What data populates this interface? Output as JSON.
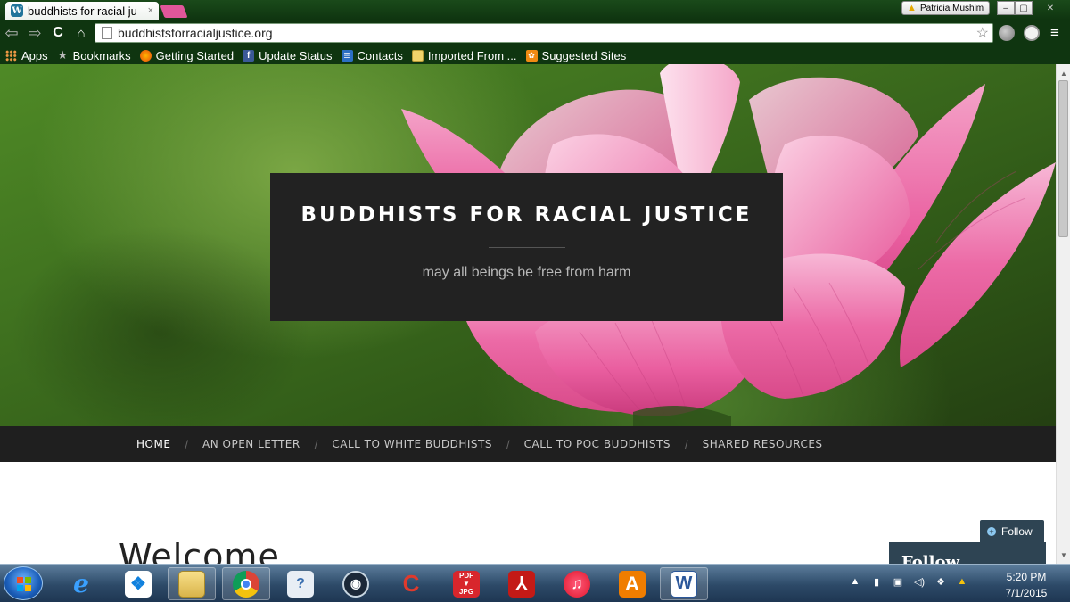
{
  "browser": {
    "tab_title": "buddhists for racial ju",
    "favicon_letter": "W",
    "tab_close": "×",
    "profile_name": "Patricia Mushim",
    "url": "buddhistsforracialjustice.org",
    "nav": {
      "back": "⇦",
      "forward": "⇨",
      "reload": "C",
      "home": "⌂"
    },
    "menu_glyph": "≡",
    "star_glyph": "☆",
    "window_buttons": {
      "minimize": "–",
      "maximize": "▢",
      "close": "✕"
    }
  },
  "bookmarks": [
    {
      "label": "Apps",
      "icon": "apps-grid-icon"
    },
    {
      "label": "Bookmarks",
      "icon": "star-icon"
    },
    {
      "label": "Getting Started",
      "icon": "firefox-icon"
    },
    {
      "label": "Update Status",
      "icon": "facebook-icon"
    },
    {
      "label": "Contacts",
      "icon": "contacts-icon"
    },
    {
      "label": "Imported From ...",
      "icon": "folder-icon"
    },
    {
      "label": "Suggested Sites",
      "icon": "suggested-sites-icon"
    }
  ],
  "site": {
    "title": "BUDDHISTS FOR RACIAL JUSTICE",
    "tagline": "may all beings be free from harm",
    "welcome_heading": "Welcome",
    "menu": [
      {
        "label": "HOME",
        "active": true
      },
      {
        "label": "AN OPEN LETTER",
        "active": false
      },
      {
        "label": "CALL TO WHITE BUDDHISTS",
        "active": false
      },
      {
        "label": "CALL TO POC BUDDHISTS",
        "active": false
      },
      {
        "label": "SHARED RESOURCES",
        "active": false
      }
    ],
    "menu_separator": "/",
    "follow_button": "Follow",
    "follow_panel_title": "Follow"
  },
  "taskbar": {
    "apps": [
      "internet-explorer",
      "dropbox",
      "file-explorer",
      "chrome",
      "help",
      "steam",
      "ccleaner",
      "pdf-to-jpg",
      "adobe-reader",
      "itunes",
      "avast",
      "word"
    ],
    "pdf_label": "PDF",
    "jpg_label": "JPG",
    "clock_time": "5:20 PM",
    "clock_date": "7/1/2015"
  },
  "colors": {
    "hero_green": "#3d6e1e",
    "lotus_pink": "#e94a93",
    "title_box": "#222222",
    "navbar": "#1f1f1f",
    "follow_bg": "#2e4453",
    "chrome_frame": "#0f3510"
  }
}
